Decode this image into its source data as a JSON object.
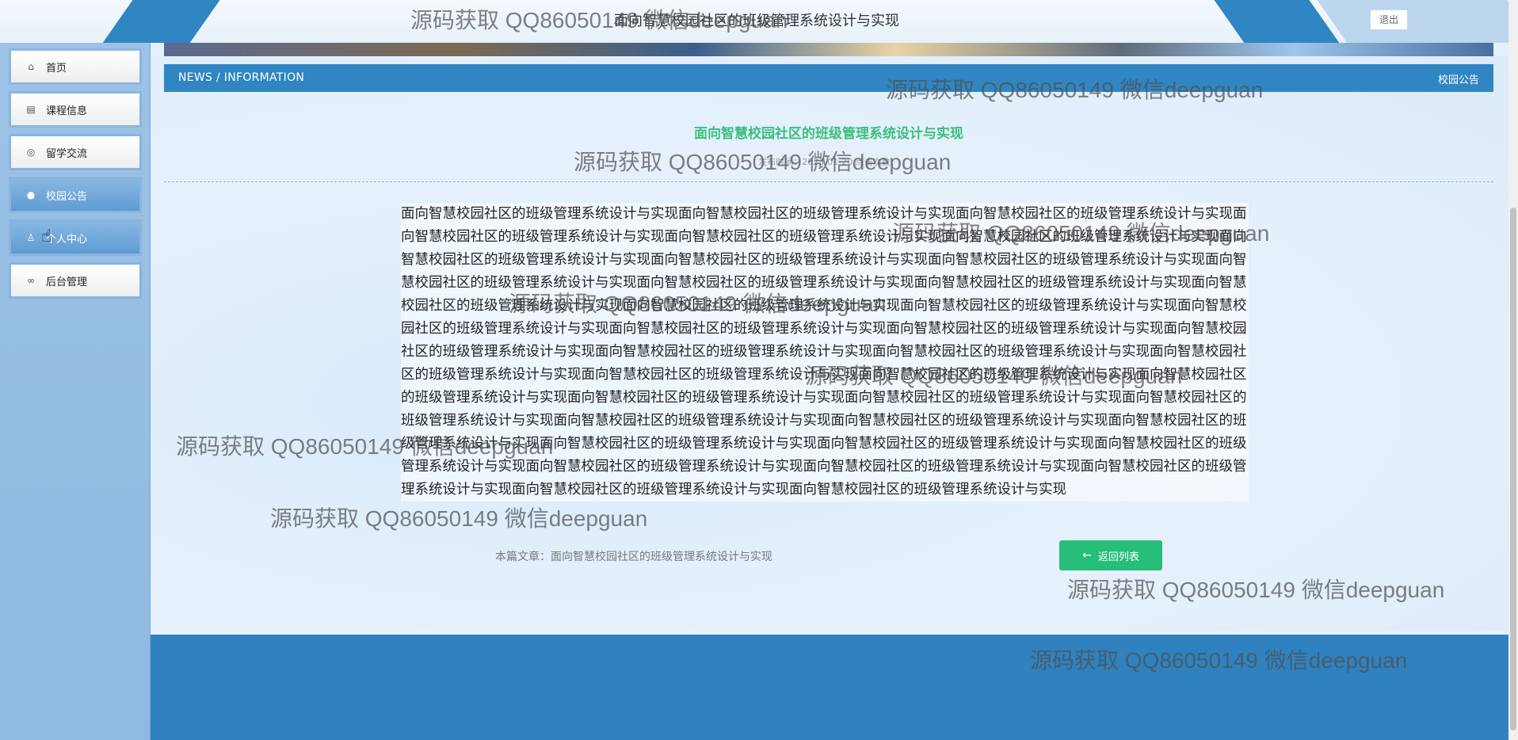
{
  "header": {
    "title": "面向智慧校园社区的班级管理系统设计与实现",
    "logout_label": "退出"
  },
  "sidebar": {
    "items": [
      {
        "label": "首页",
        "icon": "home-icon"
      },
      {
        "label": "课程信息",
        "icon": "document-icon"
      },
      {
        "label": "留学交流",
        "icon": "palette-icon"
      },
      {
        "label": "校园公告",
        "icon": "globe-icon",
        "active": true
      },
      {
        "label": "个人中心",
        "icon": "user-icon"
      },
      {
        "label": "后台管理",
        "icon": "link-icon"
      }
    ]
  },
  "news_bar": {
    "left": "NEWS / INFORMATION",
    "right": "校园公告"
  },
  "article": {
    "title": "面向智慧校园社区的班级管理系统设计与实现",
    "meta": "发布时间：2023-01-20 点击次数：",
    "body": "面向智慧校园社区的班级管理系统设计与实现面向智慧校园社区的班级管理系统设计与实现面向智慧校园社区的班级管理系统设计与实现面向智慧校园社区的班级管理系统设计与实现面向智慧校园社区的班级管理系统设计与实现面向智慧校园社区的班级管理系统设计与实现面向智慧校园社区的班级管理系统设计与实现面向智慧校园社区的班级管理系统设计与实现面向智慧校园社区的班级管理系统设计与实现面向智慧校园社区的班级管理系统设计与实现面向智慧校园社区的班级管理系统设计与实现面向智慧校园社区的班级管理系统设计与实现面向智慧校园社区的班级管理系统设计与实现面向智慧校园社区的班级管理系统设计与实现面向智慧校园社区的班级管理系统设计与实现面向智慧校园社区的班级管理系统设计与实现面向智慧校园社区的班级管理系统设计与实现面向智慧校园社区的班级管理系统设计与实现面向智慧校园社区的班级管理系统设计与实现面向智慧校园社区的班级管理系统设计与实现面向智慧校园社区的班级管理系统设计与实现面向智慧校园社区的班级管理系统设计与实现面向智慧校园社区的班级管理系统设计与实现面向智慧校园社区的班级管理系统设计与实现面向智慧校园社区的班级管理系统设计与实现面向智慧校园社区的班级管理系统设计与实现面向智慧校园社区的班级管理系统设计与实现面向智慧校园社区的班级管理系统设计与实现面向智慧校园社区的班级管理系统设计与实现面向智慧校园社区的班级管理系统设计与实现面向智慧校园社区的班级管理系统设计与实现面向智慧校园社区的班级管理系统设计与实现面向智慧校园社区的班级管理系统设计与实现面向智慧校园社区的班级管理系统设计与实现面向智慧校园社区的班级管理系统设计与实现面向智慧校园社区的班级管理系统设计与实现面向智慧校园社区的班级管理系统设计与实现面向智慧校园社区的班级管理系统设计与实现面向智慧校园社区的班级管理系统设计与实现",
    "footer_label": "本篇文章：面向智慧校园社区的班级管理系统设计与实现",
    "back_label": "返回列表"
  },
  "watermark": "源码获取 QQ86050149 微信deepguan",
  "colors": {
    "primary": "#2f86c2",
    "accent_green": "#27be7a",
    "title_green": "#3cbf7d"
  }
}
